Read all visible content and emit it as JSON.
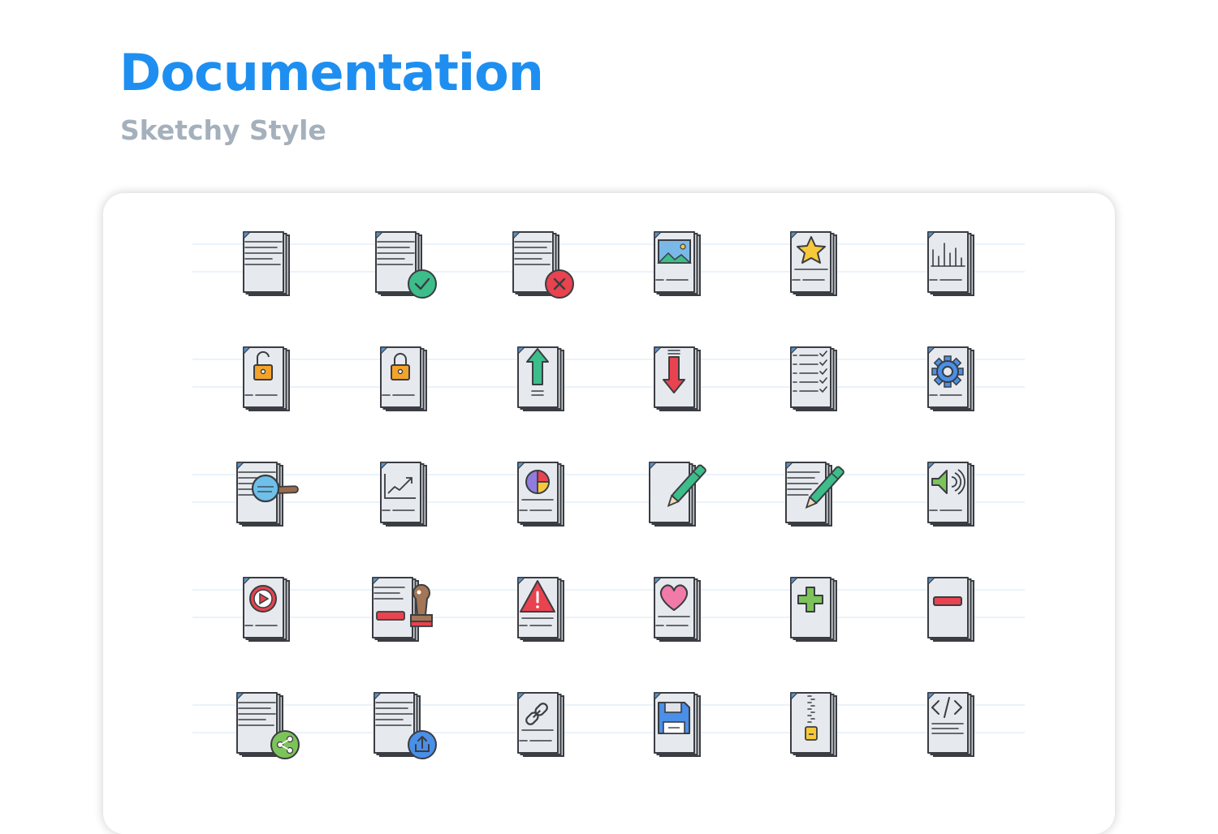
{
  "header": {
    "title": "Documentation",
    "subtitle": "Sketchy Style"
  },
  "colors": {
    "title": "#1e8ff0",
    "subtitle": "#a4b0bc",
    "page_fill": "#e6e9ed",
    "page_back": "#c9cdd2",
    "outline": "#3a3d42",
    "guide_lines": "#eaf3fb",
    "green": "#3dbd8a",
    "red": "#e8434f",
    "blue": "#4a8fe8",
    "orange": "#f4a32a",
    "yellow": "#f7c93a",
    "purple": "#8f7cdc",
    "pink": "#f27aa8",
    "lime": "#7cc45a"
  },
  "icons": [
    [
      "document-icon",
      "document-check-icon",
      "document-delete-icon",
      "document-image-icon",
      "document-star-icon",
      "document-bar-chart-icon"
    ],
    [
      "document-unlock-icon",
      "document-lock-icon",
      "document-upload-arrow-icon",
      "document-download-arrow-icon",
      "document-checklist-icon",
      "document-settings-icon"
    ],
    [
      "document-search-icon",
      "document-line-chart-icon",
      "document-pie-chart-icon",
      "document-edit-pen-icon",
      "document-write-pen-icon",
      "document-audio-icon"
    ],
    [
      "document-video-icon",
      "document-stamp-icon",
      "document-warning-icon",
      "document-favorite-icon",
      "document-add-icon",
      "document-remove-icon"
    ],
    [
      "document-share-icon",
      "document-export-icon",
      "document-link-icon",
      "document-save-icon",
      "document-zip-icon",
      "document-code-icon"
    ]
  ]
}
